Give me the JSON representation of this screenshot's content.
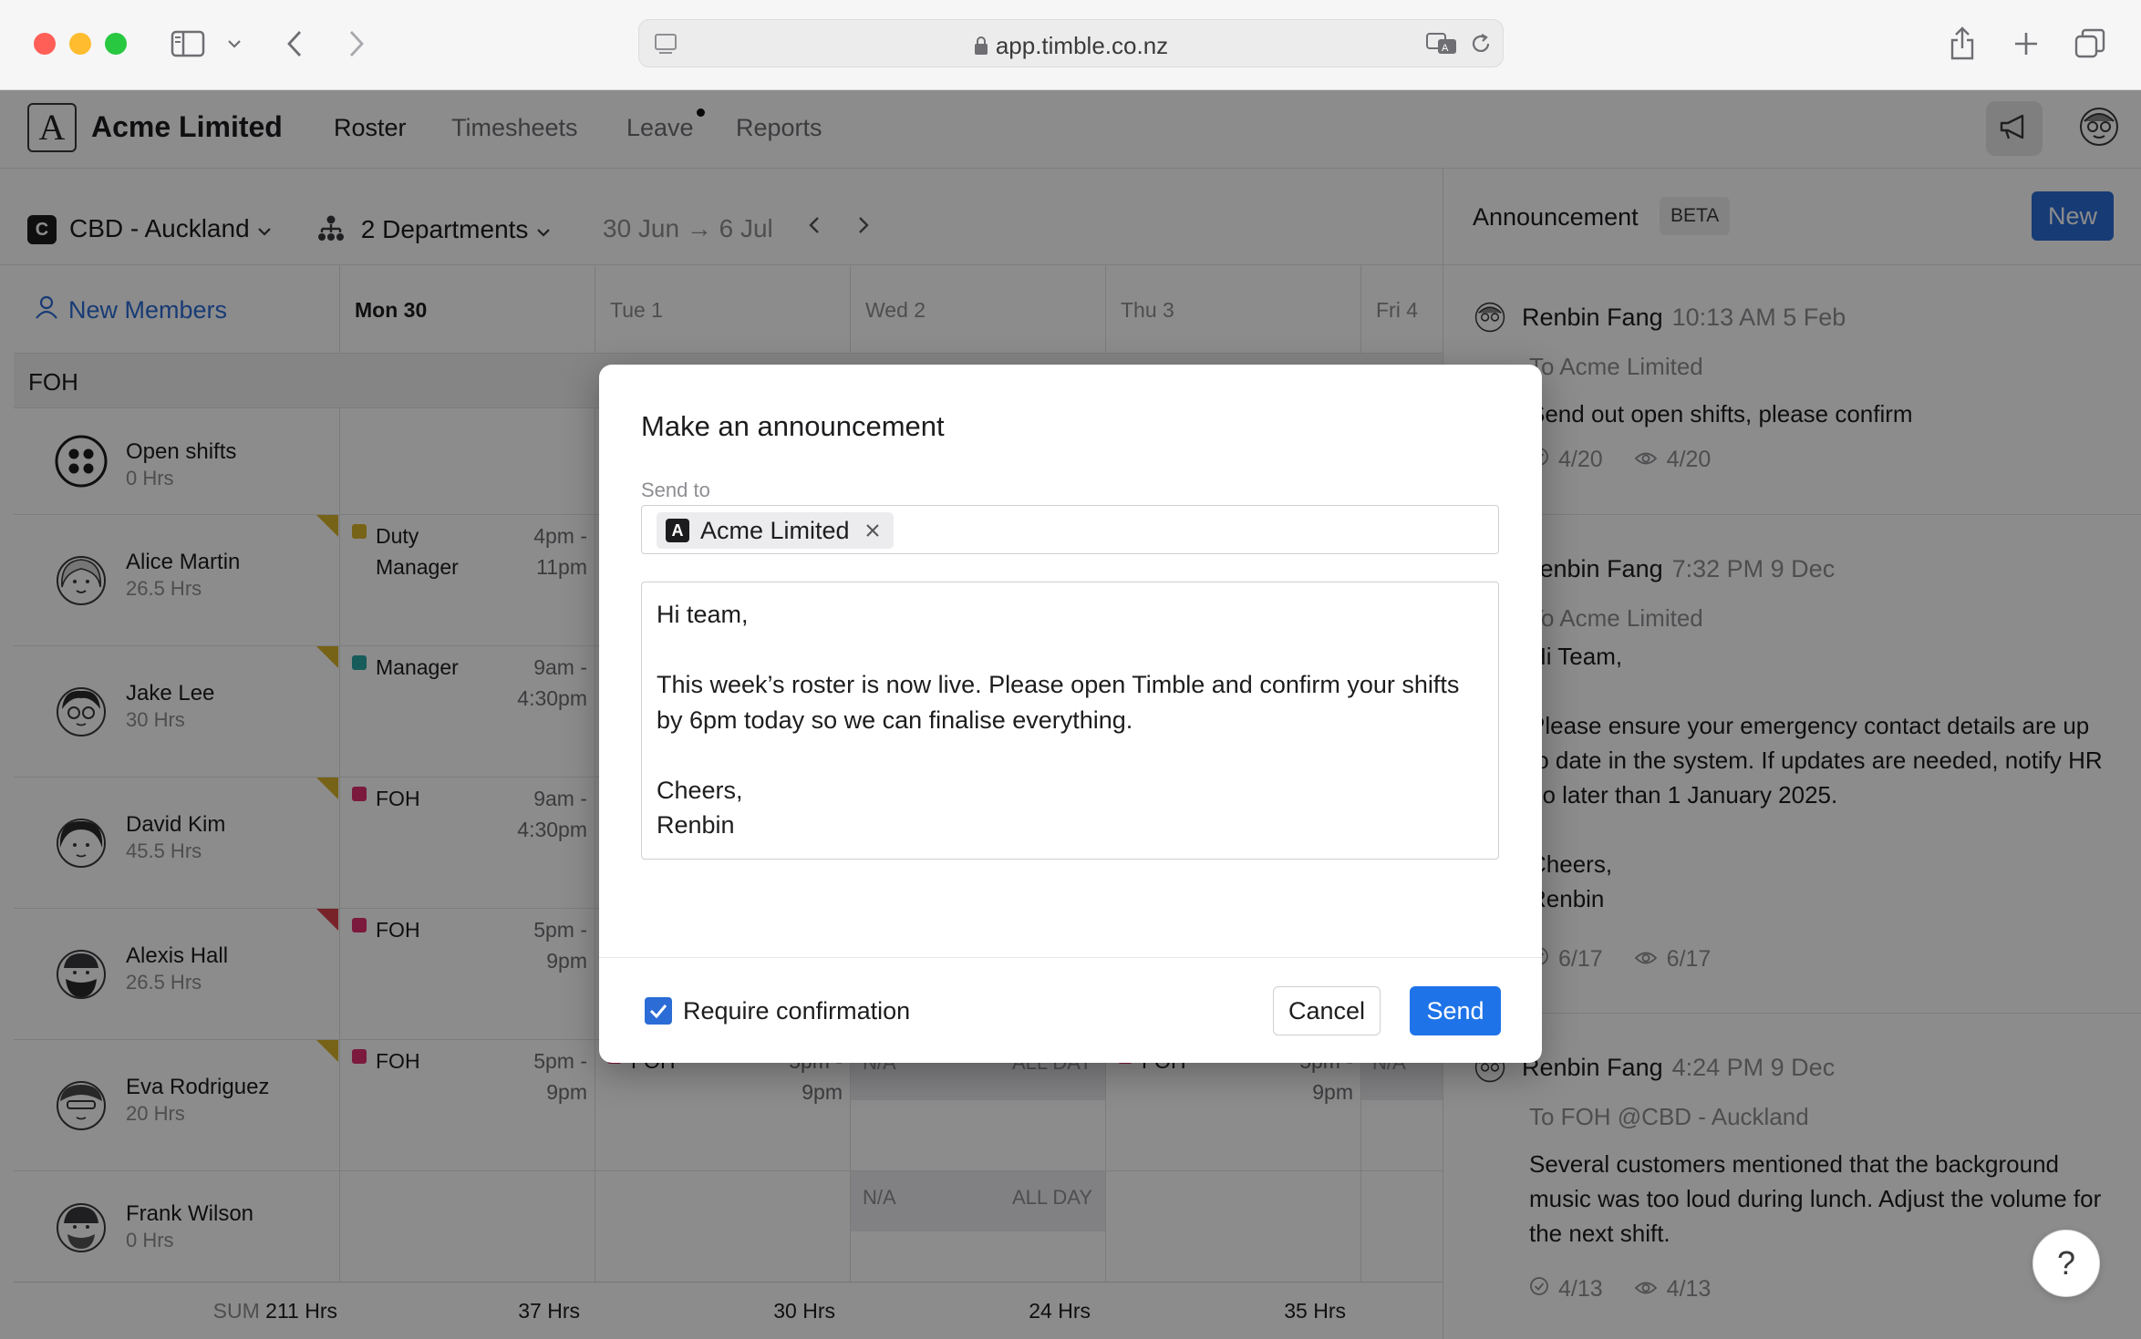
{
  "browser": {
    "url": "app.timble.co.nz"
  },
  "app": {
    "logo_letter": "A",
    "org_name": "Acme Limited",
    "nav": [
      {
        "label": "Roster"
      },
      {
        "label": "Timesheets"
      },
      {
        "label": "Leave"
      },
      {
        "label": "Reports"
      }
    ]
  },
  "toolbar": {
    "location_badge": "C",
    "location": "CBD - Auckland",
    "departments": "2 Departments",
    "date_range": "30 Jun → 6 Jul"
  },
  "roster": {
    "new_members_label": "New Members",
    "days": [
      "Mon 30",
      "Tue 1",
      "Wed 2",
      "Thu 3",
      "Fri 4"
    ],
    "section": "FOH",
    "people": [
      {
        "name": "Open shifts",
        "hours": "0 Hrs"
      },
      {
        "name": "Alice Martin",
        "hours": "26.5 Hrs",
        "shift_role": "Duty\nManager",
        "shift_time": "4pm -\n11pm",
        "color": "#d9b42a"
      },
      {
        "name": "Jake Lee",
        "hours": "30 Hrs",
        "shift_role": "Manager",
        "shift_time": "9am -\n4:30pm",
        "color": "#2aa6a6"
      },
      {
        "name": "David Kim",
        "hours": "45.5 Hrs",
        "shift_role": "FOH",
        "shift_time": "9am -\n4:30pm",
        "color": "#e0306f"
      },
      {
        "name": "Alexis Hall",
        "hours": "26.5 Hrs",
        "shift_role": "FOH",
        "shift_time": "5pm -\n9pm",
        "color": "#e0306f"
      },
      {
        "name": "Eva Rodriguez",
        "hours": "20 Hrs",
        "shift_role": "FOH",
        "shift_time": "5pm -\n9pm",
        "color": "#e0306f",
        "tue_role": "FOH",
        "tue_time": "5pm -\n9pm",
        "wed_na": "N/A",
        "wed_allday": "ALL DAY",
        "thu_role": "FOH",
        "thu_time": "5pm -\n9pm",
        "fri_na": "N/A"
      },
      {
        "name": "Frank Wilson",
        "hours": "0 Hrs",
        "wed_na": "N/A",
        "wed_allday": "ALL DAY"
      }
    ],
    "sum": {
      "label": "SUM",
      "total": "211 Hrs",
      "mon": "37 Hrs",
      "tue": "30 Hrs",
      "wed": "24 Hrs",
      "thu": "35 Hrs"
    }
  },
  "sidebar": {
    "title": "Announcement",
    "beta": "BETA",
    "new_button": "New",
    "announcements": [
      {
        "author": "Renbin Fang",
        "time": "10:13 AM 5 Feb",
        "to": "To Acme Limited",
        "body": "Send out open shifts, please confirm",
        "confirmed": "4/20",
        "seen": "4/20"
      },
      {
        "author": "Renbin Fang",
        "time": "7:32 PM 9 Dec",
        "to": "To Acme Limited",
        "body": "Hi Team,\n\nPlease ensure your emergency contact details are up to date in the system. If updates are needed, notify HR no later than 1 January 2025.\n\nCheers,\nRenbin",
        "confirmed": "6/17",
        "seen": "6/17"
      },
      {
        "author": "Renbin Fang",
        "time": "4:24 PM 9 Dec",
        "to": "To FOH @CBD - Auckland",
        "body": "Several customers mentioned that the background music was too loud during lunch. Adjust the volume for the next shift.",
        "confirmed": "4/13",
        "seen": "4/13"
      }
    ],
    "help": "?"
  },
  "modal": {
    "title": "Make an announcement",
    "send_to_label": "Send to",
    "recipient_badge": "A",
    "recipient": "Acme Limited",
    "message": "Hi team,\n\nThis week’s roster is now live. Please open Timble and confirm your shifts by 6pm today so we can finalise everything.\n\nCheers,\nRenbin",
    "require_confirmation": "Require confirmation",
    "require_confirmation_checked": true,
    "cancel": "Cancel",
    "send": "Send"
  },
  "colors": {
    "accent": "#2b6cd6",
    "send": "#1f73e8",
    "flag_yellow": "#d9b42a",
    "flag_red": "#d9414a"
  }
}
